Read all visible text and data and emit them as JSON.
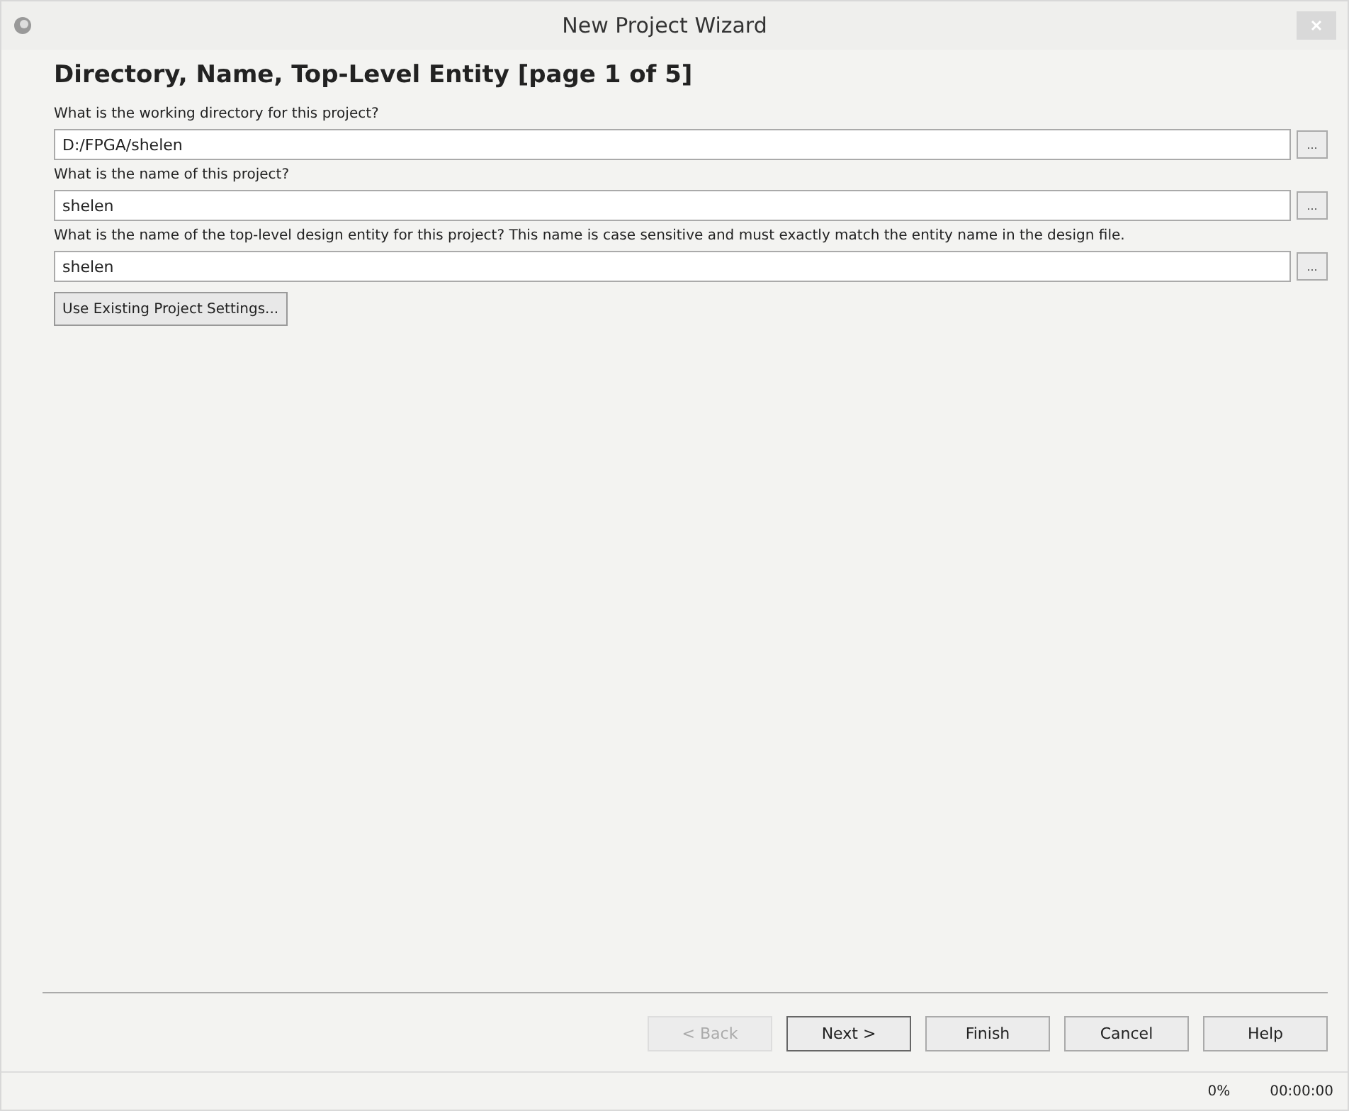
{
  "window": {
    "title": "New Project Wizard"
  },
  "heading": "Directory, Name, Top-Level Entity [page 1 of 5]",
  "fields": [
    {
      "label": "What is the working directory for this project?",
      "value": "D:/FPGA/shelen",
      "browse": "..."
    },
    {
      "label": "What is the name of this project?",
      "value": "shelen",
      "browse": "..."
    },
    {
      "label": "What is the name of the top-level design entity for this project? This name is case sensitive and must exactly match the entity name in the design file.",
      "value": "shelen",
      "browse": "..."
    }
  ],
  "settings_button": "Use Existing Project Settings...",
  "buttons": [
    {
      "label": "< Back",
      "disabled": true,
      "default": false
    },
    {
      "label": "Next >",
      "disabled": false,
      "default": true
    },
    {
      "label": "Finish",
      "disabled": false,
      "default": false
    },
    {
      "label": "Cancel",
      "disabled": false,
      "default": false
    },
    {
      "label": "Help",
      "disabled": false,
      "default": false
    }
  ],
  "status_bar": {
    "progress": "0%",
    "time": "00:00:00"
  }
}
